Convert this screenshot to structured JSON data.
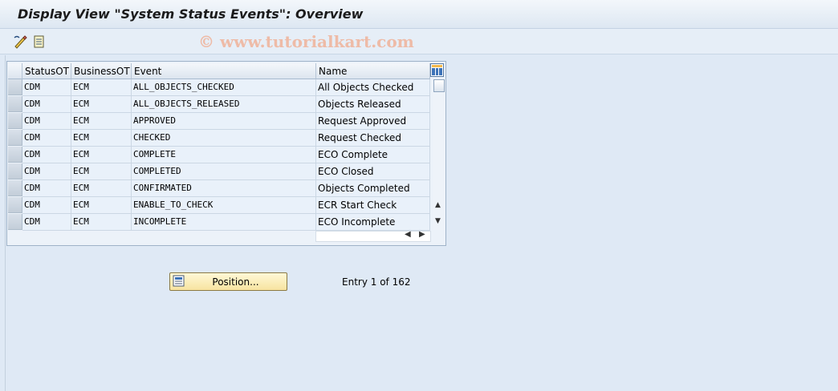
{
  "window": {
    "title": "Display View \"System Status Events\": Overview",
    "watermark": "© www.tutorialkart.com"
  },
  "toolbar": {
    "icons": [
      "display-change-icon",
      "details-icon"
    ]
  },
  "table": {
    "columns": [
      "StatusOT",
      "BusinessOT",
      "Event",
      "Name"
    ],
    "rows": [
      {
        "status_ot": "CDM",
        "business_ot": "ECM",
        "event": "ALL_OBJECTS_CHECKED",
        "name": "All Objects Checked"
      },
      {
        "status_ot": "CDM",
        "business_ot": "ECM",
        "event": "ALL_OBJECTS_RELEASED",
        "name": "Objects Released"
      },
      {
        "status_ot": "CDM",
        "business_ot": "ECM",
        "event": "APPROVED",
        "name": "Request Approved"
      },
      {
        "status_ot": "CDM",
        "business_ot": "ECM",
        "event": "CHECKED",
        "name": "Request Checked"
      },
      {
        "status_ot": "CDM",
        "business_ot": "ECM",
        "event": "COMPLETE",
        "name": "ECO Complete"
      },
      {
        "status_ot": "CDM",
        "business_ot": "ECM",
        "event": "COMPLETED",
        "name": "ECO Closed"
      },
      {
        "status_ot": "CDM",
        "business_ot": "ECM",
        "event": "CONFIRMATED",
        "name": "Objects Completed"
      },
      {
        "status_ot": "CDM",
        "business_ot": "ECM",
        "event": "ENABLE_TO_CHECK",
        "name": "ECR Start Check"
      },
      {
        "status_ot": "CDM",
        "business_ot": "ECM",
        "event": "INCOMPLETE",
        "name": "ECO Incomplete"
      }
    ]
  },
  "footer": {
    "position_button": "Position...",
    "entry_info": "Entry 1 of 162"
  },
  "colors": {
    "background": "#dfe9f5",
    "button_accent": "#f7e3a0",
    "watermark": "#f0aa8c"
  }
}
